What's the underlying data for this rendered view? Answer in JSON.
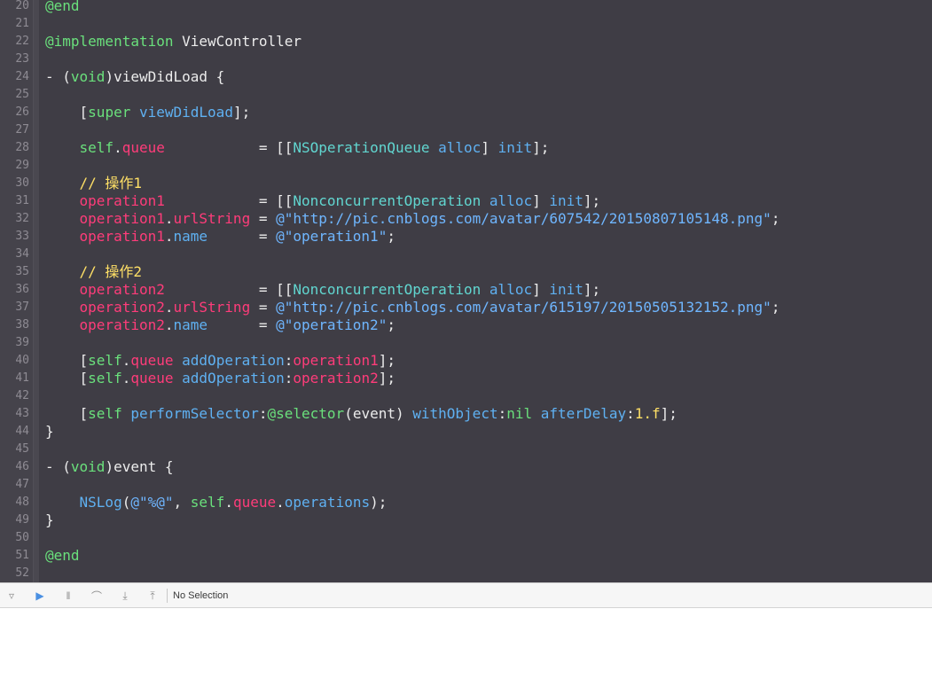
{
  "editor": {
    "lines": [
      {
        "n": "20",
        "tokens": [
          {
            "t": "@end",
            "c": "kw"
          }
        ]
      },
      {
        "n": "21",
        "tokens": []
      },
      {
        "n": "22",
        "tokens": [
          {
            "t": "@implementation",
            "c": "kw"
          },
          {
            "t": " ViewController",
            "c": "plain"
          }
        ]
      },
      {
        "n": "23",
        "tokens": []
      },
      {
        "n": "24",
        "tokens": [
          {
            "t": "- (",
            "c": "plain"
          },
          {
            "t": "void",
            "c": "kw"
          },
          {
            "t": ")viewDidLoad {",
            "c": "plain"
          }
        ]
      },
      {
        "n": "25",
        "tokens": []
      },
      {
        "n": "26",
        "tokens": [
          {
            "t": "    [",
            "c": "plain"
          },
          {
            "t": "super",
            "c": "kw"
          },
          {
            "t": " ",
            "c": "plain"
          },
          {
            "t": "viewDidLoad",
            "c": "bl"
          },
          {
            "t": "];",
            "c": "plain"
          }
        ]
      },
      {
        "n": "27",
        "tokens": []
      },
      {
        "n": "28",
        "tokens": [
          {
            "t": "    ",
            "c": "plain"
          },
          {
            "t": "self",
            "c": "kw"
          },
          {
            "t": ".",
            "c": "plain"
          },
          {
            "t": "queue",
            "c": "pk"
          },
          {
            "t": "           = [[",
            "c": "plain"
          },
          {
            "t": "NSOperationQueue",
            "c": "cls"
          },
          {
            "t": " ",
            "c": "plain"
          },
          {
            "t": "alloc",
            "c": "bl"
          },
          {
            "t": "] ",
            "c": "plain"
          },
          {
            "t": "init",
            "c": "bl"
          },
          {
            "t": "];",
            "c": "plain"
          }
        ]
      },
      {
        "n": "29",
        "tokens": []
      },
      {
        "n": "30",
        "tokens": [
          {
            "t": "    // 操作1",
            "c": "cm"
          }
        ]
      },
      {
        "n": "31",
        "tokens": [
          {
            "t": "    ",
            "c": "plain"
          },
          {
            "t": "operation1",
            "c": "pk"
          },
          {
            "t": "           = [[",
            "c": "plain"
          },
          {
            "t": "NonconcurrentOperation",
            "c": "cls"
          },
          {
            "t": " ",
            "c": "plain"
          },
          {
            "t": "alloc",
            "c": "bl"
          },
          {
            "t": "] ",
            "c": "plain"
          },
          {
            "t": "init",
            "c": "bl"
          },
          {
            "t": "];",
            "c": "plain"
          }
        ]
      },
      {
        "n": "32",
        "tokens": [
          {
            "t": "    ",
            "c": "plain"
          },
          {
            "t": "operation1",
            "c": "pk"
          },
          {
            "t": ".",
            "c": "plain"
          },
          {
            "t": "urlString",
            "c": "pk"
          },
          {
            "t": " = ",
            "c": "plain"
          },
          {
            "t": "@\"http://pic.cnblogs.com/avatar/607542/20150807105148.png\"",
            "c": "str"
          },
          {
            "t": ";",
            "c": "plain"
          }
        ]
      },
      {
        "n": "33",
        "tokens": [
          {
            "t": "    ",
            "c": "plain"
          },
          {
            "t": "operation1",
            "c": "pk"
          },
          {
            "t": ".",
            "c": "plain"
          },
          {
            "t": "name",
            "c": "bl"
          },
          {
            "t": "      = ",
            "c": "plain"
          },
          {
            "t": "@\"operation1\"",
            "c": "str"
          },
          {
            "t": ";",
            "c": "plain"
          }
        ]
      },
      {
        "n": "34",
        "tokens": []
      },
      {
        "n": "35",
        "tokens": [
          {
            "t": "    // 操作2",
            "c": "cm"
          }
        ]
      },
      {
        "n": "36",
        "tokens": [
          {
            "t": "    ",
            "c": "plain"
          },
          {
            "t": "operation2",
            "c": "pk"
          },
          {
            "t": "           = [[",
            "c": "plain"
          },
          {
            "t": "NonconcurrentOperation",
            "c": "cls"
          },
          {
            "t": " ",
            "c": "plain"
          },
          {
            "t": "alloc",
            "c": "bl"
          },
          {
            "t": "] ",
            "c": "plain"
          },
          {
            "t": "init",
            "c": "bl"
          },
          {
            "t": "];",
            "c": "plain"
          }
        ]
      },
      {
        "n": "37",
        "tokens": [
          {
            "t": "    ",
            "c": "plain"
          },
          {
            "t": "operation2",
            "c": "pk"
          },
          {
            "t": ".",
            "c": "plain"
          },
          {
            "t": "urlString",
            "c": "pk"
          },
          {
            "t": " = ",
            "c": "plain"
          },
          {
            "t": "@\"http://pic.cnblogs.com/avatar/615197/20150505132152.png\"",
            "c": "str"
          },
          {
            "t": ";",
            "c": "plain"
          }
        ]
      },
      {
        "n": "38",
        "tokens": [
          {
            "t": "    ",
            "c": "plain"
          },
          {
            "t": "operation2",
            "c": "pk"
          },
          {
            "t": ".",
            "c": "plain"
          },
          {
            "t": "name",
            "c": "bl"
          },
          {
            "t": "      = ",
            "c": "plain"
          },
          {
            "t": "@\"operation2\"",
            "c": "str"
          },
          {
            "t": ";",
            "c": "plain"
          }
        ]
      },
      {
        "n": "39",
        "tokens": []
      },
      {
        "n": "40",
        "tokens": [
          {
            "t": "    [",
            "c": "plain"
          },
          {
            "t": "self",
            "c": "kw"
          },
          {
            "t": ".",
            "c": "plain"
          },
          {
            "t": "queue",
            "c": "pk"
          },
          {
            "t": " ",
            "c": "plain"
          },
          {
            "t": "addOperation",
            "c": "bl"
          },
          {
            "t": ":",
            "c": "plain"
          },
          {
            "t": "operation1",
            "c": "pk"
          },
          {
            "t": "];",
            "c": "plain"
          }
        ]
      },
      {
        "n": "41",
        "tokens": [
          {
            "t": "    [",
            "c": "plain"
          },
          {
            "t": "self",
            "c": "kw"
          },
          {
            "t": ".",
            "c": "plain"
          },
          {
            "t": "queue",
            "c": "pk"
          },
          {
            "t": " ",
            "c": "plain"
          },
          {
            "t": "addOperation",
            "c": "bl"
          },
          {
            "t": ":",
            "c": "plain"
          },
          {
            "t": "operation2",
            "c": "pk"
          },
          {
            "t": "];",
            "c": "plain"
          }
        ]
      },
      {
        "n": "42",
        "tokens": []
      },
      {
        "n": "43",
        "tokens": [
          {
            "t": "    [",
            "c": "plain"
          },
          {
            "t": "self",
            "c": "kw"
          },
          {
            "t": " ",
            "c": "plain"
          },
          {
            "t": "performSelector",
            "c": "bl"
          },
          {
            "t": ":",
            "c": "plain"
          },
          {
            "t": "@selector",
            "c": "kw"
          },
          {
            "t": "(event) ",
            "c": "plain"
          },
          {
            "t": "withObject",
            "c": "bl"
          },
          {
            "t": ":",
            "c": "plain"
          },
          {
            "t": "nil",
            "c": "kw"
          },
          {
            "t": " ",
            "c": "plain"
          },
          {
            "t": "afterDelay",
            "c": "bl"
          },
          {
            "t": ":",
            "c": "plain"
          },
          {
            "t": "1.f",
            "c": "num"
          },
          {
            "t": "];",
            "c": "plain"
          }
        ]
      },
      {
        "n": "44",
        "tokens": [
          {
            "t": "}",
            "c": "plain"
          }
        ]
      },
      {
        "n": "45",
        "tokens": []
      },
      {
        "n": "46",
        "tokens": [
          {
            "t": "- (",
            "c": "plain"
          },
          {
            "t": "void",
            "c": "kw"
          },
          {
            "t": ")event {",
            "c": "plain"
          }
        ]
      },
      {
        "n": "47",
        "tokens": []
      },
      {
        "n": "48",
        "tokens": [
          {
            "t": "    ",
            "c": "plain"
          },
          {
            "t": "NSLog",
            "c": "bl"
          },
          {
            "t": "(",
            "c": "plain"
          },
          {
            "t": "@\"%@\"",
            "c": "str"
          },
          {
            "t": ", ",
            "c": "plain"
          },
          {
            "t": "self",
            "c": "kw"
          },
          {
            "t": ".",
            "c": "plain"
          },
          {
            "t": "queue",
            "c": "pk"
          },
          {
            "t": ".",
            "c": "plain"
          },
          {
            "t": "operations",
            "c": "bl"
          },
          {
            "t": ");",
            "c": "plain"
          }
        ]
      },
      {
        "n": "49",
        "tokens": [
          {
            "t": "}",
            "c": "plain"
          }
        ]
      },
      {
        "n": "50",
        "tokens": []
      },
      {
        "n": "51",
        "tokens": [
          {
            "t": "@end",
            "c": "kw"
          }
        ]
      },
      {
        "n": "52",
        "tokens": []
      }
    ]
  },
  "debug_bar": {
    "buttons": [
      {
        "name": "hide-debug-area-icon",
        "glyph": "▿"
      },
      {
        "name": "breakpoints-toggle-icon",
        "glyph": "▶"
      },
      {
        "name": "pause-icon",
        "glyph": "‖"
      },
      {
        "name": "step-over-icon",
        "glyph": "⌒"
      },
      {
        "name": "step-into-icon",
        "glyph": "⤓"
      },
      {
        "name": "step-out-icon",
        "glyph": "⤒"
      }
    ],
    "status": "No Selection"
  },
  "colors": {
    "editor_bg": "#3f3d45",
    "keyword": "#6ae07c",
    "property": "#ff3c7a",
    "method": "#5fb1f2",
    "class": "#61d6d0",
    "string": "#6fb6ff",
    "comment": "#ffe066"
  }
}
